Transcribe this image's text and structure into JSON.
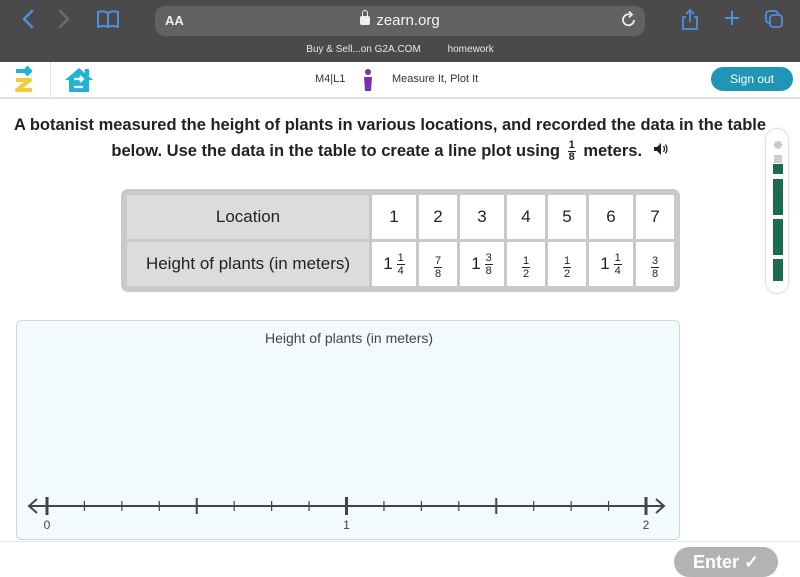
{
  "browser": {
    "back_icon": "chevron-left",
    "forward_icon": "chevron-right",
    "reader_icon": "book",
    "text_size_label": "AA",
    "url": "zearn.org",
    "reload_icon": "reload",
    "share_icon": "share",
    "new_tab_icon": "plus",
    "tabs_icon": "tabs",
    "bookmarks": [
      "Buy & Sell...on G2A.COM",
      "homework"
    ]
  },
  "app": {
    "lesson_code": "M4|L1",
    "lesson_title": "Measure It, Plot It",
    "sign_out_label": "Sign out",
    "brand_color": "#1f96b5"
  },
  "question": {
    "text_before": "A botanist measured the height of plants in various locations, and recorded the data in the table below. Use the data in the table to create a line plot using",
    "fraction": {
      "numerator": "1",
      "denominator": "8"
    },
    "text_after": "meters."
  },
  "progress": {
    "completed_segments": 3,
    "total_segments": 4,
    "color": "#1b6b4c"
  },
  "table": {
    "row_headers": [
      "Location",
      "Height of plants (in meters)"
    ],
    "locations": [
      "1",
      "2",
      "3",
      "4",
      "5",
      "6",
      "7"
    ],
    "heights": [
      {
        "whole": "1",
        "numerator": "1",
        "denominator": "4"
      },
      {
        "whole": "",
        "numerator": "7",
        "denominator": "8"
      },
      {
        "whole": "1",
        "numerator": "3",
        "denominator": "8"
      },
      {
        "whole": "",
        "numerator": "1",
        "denominator": "2"
      },
      {
        "whole": "",
        "numerator": "1",
        "denominator": "2"
      },
      {
        "whole": "1",
        "numerator": "1",
        "denominator": "4"
      },
      {
        "whole": "",
        "numerator": "3",
        "denominator": "8"
      }
    ]
  },
  "line_plot": {
    "title": "Height of plants (in meters)",
    "axis_min": 0,
    "axis_max": 2,
    "tick_interval": 0.125,
    "major_tick_interval": 0.5,
    "labels": [
      {
        "value": 0,
        "text": "0"
      },
      {
        "value": 1,
        "text": "1"
      },
      {
        "value": 2,
        "text": "2"
      }
    ],
    "points": []
  },
  "enter_label": "Enter ✓"
}
